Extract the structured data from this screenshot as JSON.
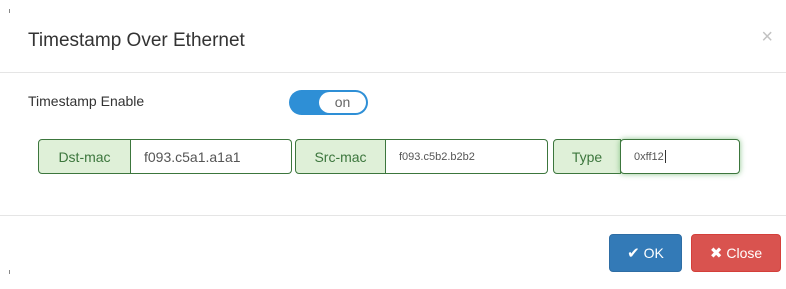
{
  "dialog": {
    "title": "Timestamp Over Ethernet",
    "close_symbol": "×"
  },
  "enable": {
    "label": "Timestamp Enable",
    "toggle_text": "on",
    "toggle_state": true
  },
  "fields": {
    "dst_mac": {
      "label": "Dst-mac",
      "value": "f093.c5a1.a1a1"
    },
    "src_mac": {
      "label": "Src-mac",
      "value": "f093.c5b2.b2b2"
    },
    "type": {
      "label": "Type",
      "value": "0xff12"
    }
  },
  "footer": {
    "ok_label": "OK",
    "ok_icon": "check-icon",
    "close_label": "Close",
    "close_icon": "x-icon"
  },
  "colors": {
    "primary": "#337ab7",
    "danger": "#d9534f",
    "success_bg": "#dff0d8",
    "success_border": "#3c763d",
    "toggle": "#2e8fd6"
  }
}
